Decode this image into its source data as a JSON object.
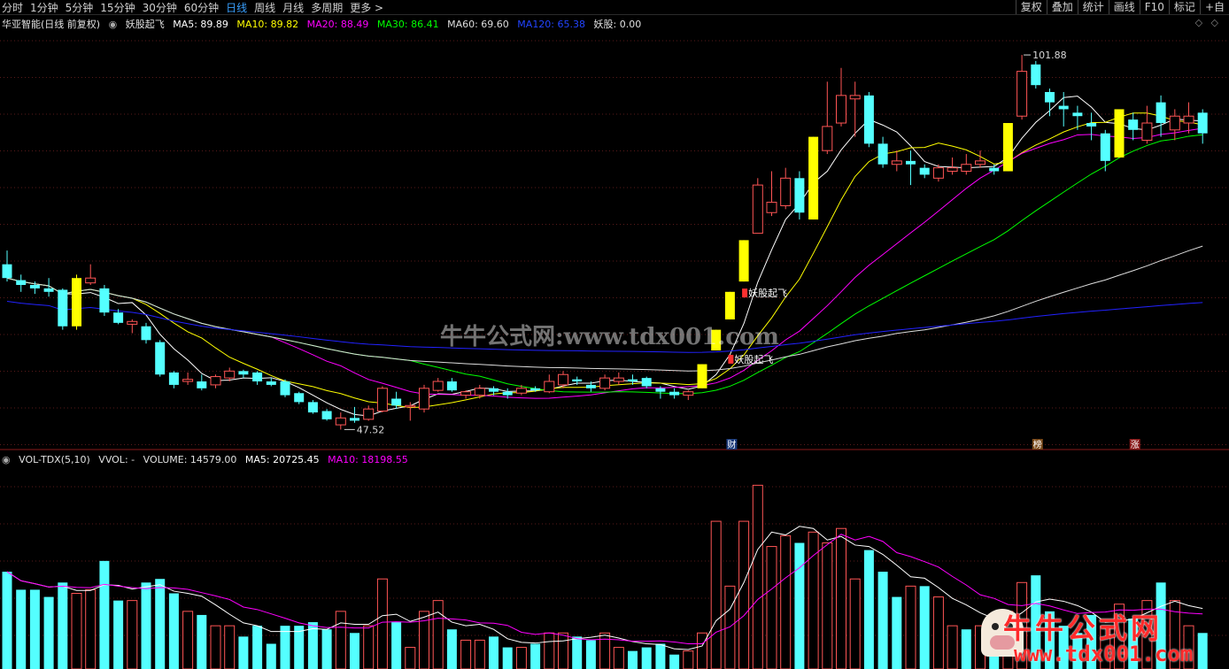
{
  "toolbar": {
    "periods": [
      "分时",
      "1分钟",
      "5分钟",
      "15分钟",
      "30分钟",
      "60分钟",
      "日线",
      "周线",
      "月线",
      "多周期",
      "更多 >"
    ],
    "active_period": "日线",
    "right_buttons": [
      "复权",
      "叠加",
      "统计",
      "画线",
      "F10",
      "标记",
      "+自"
    ]
  },
  "main_info": {
    "stock": "华亚智能(日线 前复权)",
    "formula": "妖股起飞",
    "ma5": "MA5: 89.89",
    "ma10": "MA10: 89.82",
    "ma20": "MA20: 88.49",
    "ma30": "MA30: 86.41",
    "ma60": "MA60: 69.60",
    "ma120": "MA120: 65.38",
    "yaogu": "妖股: 0.00"
  },
  "annotations": {
    "high": "101.88",
    "low": "47.52",
    "signal1": "妖股起飞",
    "signal2": "妖股起飞",
    "event_cai": "财",
    "event_bang": "榜",
    "event_zhang": "涨"
  },
  "vol_info": {
    "name": "VOL-TDX(5,10)",
    "vvol": "VVOL: -",
    "volume": "VOLUME: 14579.00",
    "ma5": "MA5: 20725.45",
    "ma10": "MA10: 18198.55"
  },
  "watermarks": {
    "center": "牛牛公式网:www.tdx001.com",
    "brand_cn": "牛牛公式网",
    "brand_url": "www.tdx001.com"
  },
  "colors": {
    "up": "#ff5555",
    "down": "#54ffff",
    "signal": "#ffff00",
    "ma5": "#ffffff",
    "ma10": "#ffff00",
    "ma20": "#ff00ff",
    "ma30": "#00ff00",
    "ma60": "#dddddd",
    "ma120": "#2222ff"
  },
  "chart_data": {
    "type": "candlestick",
    "candles": [
      [
        71.5,
        69.5,
        73.5,
        69.0,
        "d"
      ],
      [
        69.2,
        68.5,
        70.0,
        67.5,
        "d"
      ],
      [
        68.5,
        68.0,
        69.0,
        67.2,
        "d"
      ],
      [
        68.0,
        67.5,
        69.5,
        66.8,
        "d"
      ],
      [
        67.8,
        62.5,
        68.0,
        62.0,
        "d"
      ],
      [
        62.5,
        69.5,
        70.0,
        62.0,
        "s"
      ],
      [
        68.8,
        69.5,
        71.5,
        68.5,
        "u"
      ],
      [
        68.0,
        64.5,
        68.5,
        64.0,
        "d"
      ],
      [
        64.5,
        63.0,
        65.0,
        62.8,
        "d"
      ],
      [
        62.8,
        63.2,
        63.5,
        61.5,
        "u"
      ],
      [
        62.5,
        60.5,
        63.0,
        60.0,
        "d"
      ],
      [
        60.2,
        55.5,
        60.5,
        55.2,
        "d"
      ],
      [
        55.8,
        54.0,
        56.0,
        53.5,
        "d"
      ],
      [
        54.5,
        54.8,
        55.8,
        54.0,
        "u"
      ],
      [
        54.5,
        53.5,
        55.5,
        53.2,
        "d"
      ],
      [
        54.0,
        55.2,
        55.5,
        53.5,
        "u"
      ],
      [
        55.0,
        56.0,
        56.5,
        54.5,
        "u"
      ],
      [
        56.0,
        55.5,
        56.2,
        55.0,
        "d"
      ],
      [
        55.8,
        54.5,
        56.0,
        54.0,
        "d"
      ],
      [
        54.5,
        54.0,
        55.0,
        53.8,
        "d"
      ],
      [
        54.5,
        52.5,
        54.8,
        52.2,
        "d"
      ],
      [
        52.8,
        51.5,
        53.0,
        51.2,
        "d"
      ],
      [
        51.5,
        50.0,
        51.8,
        49.8,
        "d"
      ],
      [
        50.2,
        49.0,
        50.5,
        48.8,
        "d"
      ],
      [
        48.2,
        49.2,
        50.0,
        47.52,
        "u"
      ],
      [
        49.2,
        48.8,
        50.8,
        48.5,
        "d"
      ],
      [
        49.0,
        50.5,
        51.0,
        48.8,
        "u"
      ],
      [
        50.2,
        53.5,
        53.8,
        50.0,
        "u"
      ],
      [
        52.0,
        51.0,
        53.0,
        50.5,
        "d"
      ],
      [
        50.8,
        51.0,
        51.5,
        48.8,
        "u"
      ],
      [
        50.5,
        53.5,
        54.0,
        50.0,
        "u"
      ],
      [
        53.2,
        54.5,
        55.0,
        53.0,
        "u"
      ],
      [
        54.5,
        53.2,
        55.0,
        53.0,
        "d"
      ],
      [
        52.5,
        53.0,
        53.2,
        52.0,
        "u"
      ],
      [
        52.5,
        53.5,
        54.0,
        52.0,
        "u"
      ],
      [
        53.5,
        53.0,
        53.8,
        52.5,
        "d"
      ],
      [
        53.0,
        52.5,
        53.5,
        52.0,
        "d"
      ],
      [
        52.8,
        53.5,
        54.0,
        52.5,
        "u"
      ],
      [
        53.5,
        53.2,
        53.8,
        53.0,
        "d"
      ],
      [
        53.0,
        54.5,
        55.5,
        52.8,
        "u"
      ],
      [
        54.0,
        55.5,
        56.0,
        53.5,
        "u"
      ],
      [
        54.8,
        54.5,
        55.2,
        54.0,
        "d"
      ],
      [
        54.0,
        53.5,
        54.5,
        53.0,
        "d"
      ],
      [
        53.5,
        55.0,
        55.5,
        53.2,
        "u"
      ],
      [
        54.5,
        55.0,
        55.8,
        54.0,
        "u"
      ],
      [
        54.8,
        54.5,
        55.5,
        54.0,
        "d"
      ],
      [
        55.0,
        53.8,
        55.2,
        53.5,
        "d"
      ],
      [
        53.5,
        53.0,
        53.8,
        52.0,
        "d"
      ],
      [
        53.0,
        52.5,
        53.5,
        52.0,
        "d"
      ],
      [
        52.5,
        53.0,
        53.2,
        51.8,
        "u"
      ],
      [
        53.5,
        57.0,
        57.0,
        53.5,
        "s"
      ],
      [
        59.0,
        62.0,
        62.0,
        59.0,
        "s"
      ],
      [
        63.5,
        67.5,
        67.5,
        63.5,
        "s"
      ],
      [
        69.0,
        75.0,
        75.0,
        69.0,
        "s"
      ],
      [
        76.0,
        83.0,
        84.0,
        76.0,
        "u"
      ],
      [
        79.0,
        80.5,
        85.0,
        78.5,
        "u"
      ],
      [
        80.0,
        84.0,
        85.5,
        79.5,
        "u"
      ],
      [
        84.0,
        79.0,
        85.0,
        78.0,
        "d"
      ],
      [
        78.0,
        90.0,
        90.0,
        78.0,
        "s"
      ],
      [
        88.0,
        91.5,
        98.0,
        87.5,
        "u"
      ],
      [
        92.0,
        96.0,
        100.0,
        91.5,
        "u"
      ],
      [
        95.5,
        96.0,
        98.0,
        90.0,
        "u"
      ],
      [
        96.0,
        89.0,
        96.5,
        88.5,
        "d"
      ],
      [
        89.0,
        86.0,
        90.0,
        85.5,
        "d"
      ],
      [
        86.0,
        86.5,
        88.0,
        85.0,
        "u"
      ],
      [
        86.5,
        86.0,
        88.0,
        83.0,
        "d"
      ],
      [
        85.5,
        84.5,
        86.0,
        84.0,
        "d"
      ],
      [
        84.0,
        85.5,
        86.0,
        83.5,
        "u"
      ],
      [
        85.0,
        85.5,
        87.0,
        84.5,
        "u"
      ],
      [
        85.0,
        86.0,
        87.5,
        84.5,
        "u"
      ],
      [
        86.0,
        86.5,
        88.0,
        85.5,
        "u"
      ],
      [
        85.5,
        85.0,
        86.0,
        84.5,
        "d"
      ],
      [
        85.0,
        92.0,
        92.0,
        85.0,
        "s"
      ],
      [
        93.0,
        99.5,
        101.88,
        92.5,
        "u"
      ],
      [
        100.5,
        97.5,
        101.0,
        97.0,
        "d"
      ],
      [
        96.5,
        95.0,
        97.0,
        93.0,
        "d"
      ],
      [
        94.0,
        94.5,
        96.5,
        91.5,
        "d"
      ],
      [
        93.5,
        93.0,
        94.5,
        91.0,
        "d"
      ],
      [
        92.0,
        91.5,
        93.5,
        89.5,
        "d"
      ],
      [
        90.5,
        86.5,
        91.0,
        85.0,
        "d"
      ],
      [
        87.0,
        94.0,
        94.0,
        87.0,
        "s"
      ],
      [
        92.5,
        91.0,
        93.5,
        89.5,
        "d"
      ],
      [
        89.5,
        92.0,
        94.5,
        89.0,
        "u"
      ],
      [
        92.0,
        95.0,
        96.0,
        90.0,
        "d"
      ],
      [
        93.0,
        91.0,
        94.0,
        89.5,
        "u"
      ],
      [
        92.0,
        93.0,
        95.0,
        90.5,
        "u"
      ],
      [
        93.5,
        90.5,
        94.0,
        89.0,
        "d"
      ]
    ],
    "volume": [
      [
        13.5,
        "d"
      ],
      [
        11.0,
        "d"
      ],
      [
        11.0,
        "d"
      ],
      [
        10.0,
        "d"
      ],
      [
        12.0,
        "d"
      ],
      [
        10.5,
        "u"
      ],
      [
        11.0,
        "u"
      ],
      [
        15.0,
        "d"
      ],
      [
        9.5,
        "d"
      ],
      [
        9.5,
        "u"
      ],
      [
        12.0,
        "d"
      ],
      [
        12.5,
        "d"
      ],
      [
        10.5,
        "d"
      ],
      [
        8.0,
        "u"
      ],
      [
        7.5,
        "d"
      ],
      [
        6.0,
        "u"
      ],
      [
        6.0,
        "u"
      ],
      [
        4.5,
        "d"
      ],
      [
        6.0,
        "d"
      ],
      [
        3.5,
        "d"
      ],
      [
        6.0,
        "d"
      ],
      [
        6.0,
        "d"
      ],
      [
        6.5,
        "d"
      ],
      [
        5.5,
        "d"
      ],
      [
        8.0,
        "u"
      ],
      [
        5.0,
        "d"
      ],
      [
        6.0,
        "u"
      ],
      [
        12.5,
        "u"
      ],
      [
        6.5,
        "d"
      ],
      [
        3.0,
        "u"
      ],
      [
        8.0,
        "u"
      ],
      [
        9.5,
        "u"
      ],
      [
        5.5,
        "d"
      ],
      [
        4.0,
        "u"
      ],
      [
        4.0,
        "u"
      ],
      [
        4.5,
        "d"
      ],
      [
        3.0,
        "d"
      ],
      [
        3.0,
        "u"
      ],
      [
        3.5,
        "d"
      ],
      [
        5.0,
        "u"
      ],
      [
        5.0,
        "u"
      ],
      [
        4.5,
        "d"
      ],
      [
        4.0,
        "d"
      ],
      [
        5.0,
        "u"
      ],
      [
        3.0,
        "u"
      ],
      [
        2.5,
        "d"
      ],
      [
        3.0,
        "d"
      ],
      [
        3.5,
        "d"
      ],
      [
        2.0,
        "d"
      ],
      [
        2.5,
        "u"
      ],
      [
        5.0,
        "u"
      ],
      [
        20.5,
        "u"
      ],
      [
        11.5,
        "u"
      ],
      [
        20.5,
        "u"
      ],
      [
        25.5,
        "u"
      ],
      [
        17.0,
        "u"
      ],
      [
        18.5,
        "u"
      ],
      [
        17.5,
        "d"
      ],
      [
        19.0,
        "u"
      ],
      [
        17.5,
        "u"
      ],
      [
        19.5,
        "u"
      ],
      [
        12.5,
        "u"
      ],
      [
        16.5,
        "d"
      ],
      [
        13.5,
        "d"
      ],
      [
        10.0,
        "d"
      ],
      [
        11.5,
        "u"
      ],
      [
        11.5,
        "d"
      ],
      [
        10.0,
        "u"
      ],
      [
        6.0,
        "u"
      ],
      [
        5.5,
        "d"
      ],
      [
        6.0,
        "u"
      ],
      [
        7.5,
        "d"
      ],
      [
        8.0,
        "u"
      ],
      [
        12.0,
        "u"
      ],
      [
        13.0,
        "d"
      ],
      [
        8.0,
        "d"
      ],
      [
        6.0,
        "d"
      ],
      [
        5.0,
        "d"
      ],
      [
        7.5,
        "d"
      ],
      [
        6.0,
        "u"
      ],
      [
        9.0,
        "u"
      ],
      [
        7.0,
        "d"
      ],
      [
        9.5,
        "u"
      ],
      [
        12.0,
        "d"
      ],
      [
        9.5,
        "u"
      ],
      [
        6.0,
        "u"
      ],
      [
        5.0,
        "d"
      ]
    ],
    "ylim": [
      45,
      106
    ],
    "vol_ylim": [
      0,
      28
    ]
  }
}
